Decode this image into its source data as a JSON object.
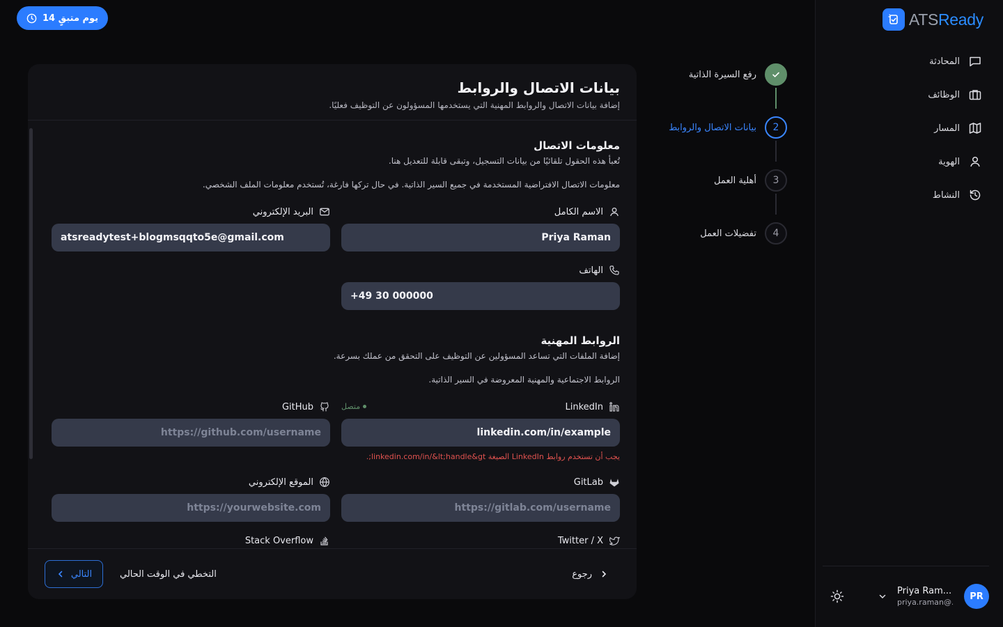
{
  "trial": {
    "label": "14 يوم متبقٍ",
    "icon": "clock-icon"
  },
  "brand": {
    "ats": "ATS",
    "ready": "Ready",
    "icon": "logo-icon"
  },
  "nav": {
    "items": [
      {
        "label": "المحادثة",
        "icon": "chat-icon"
      },
      {
        "label": "الوظائف",
        "icon": "briefcase-icon"
      },
      {
        "label": "المسار",
        "icon": "map-icon"
      },
      {
        "label": "الهوية",
        "icon": "user-icon"
      },
      {
        "label": "النشاط",
        "icon": "history-icon"
      }
    ]
  },
  "user": {
    "name": "Priya Ram...",
    "email": "priya.raman@...",
    "initials": "PR"
  },
  "stepper": {
    "steps": [
      {
        "label": "رفع السيرة الذاتية",
        "state": "done",
        "number": "✓"
      },
      {
        "label": "بيانات الاتصال والروابط",
        "state": "active",
        "number": "2"
      },
      {
        "label": "أهلية العمل",
        "state": "pending",
        "number": "3"
      },
      {
        "label": "تفضيلات العمل",
        "state": "pending",
        "number": "4"
      }
    ]
  },
  "card": {
    "title": "بيانات الاتصال والروابط",
    "subtitle": "إضافة بيانات الاتصال والروابط المهنية التي يستخدمها المسؤولون عن التوظيف فعليًا."
  },
  "contact": {
    "title": "معلومات الاتصال",
    "subtitle": "تُعبأ هذه الحقول تلقائيًا من بيانات التسجيل، وتبقى قابلة للتعديل هنا.",
    "note": "معلومات الاتصال الافتراضية المستخدمة في جميع السير الذاتية. في حال تركها فارغة، تُستخدم معلومات الملف الشخصي.",
    "full_name_label": "الاسم الكامل",
    "full_name_value": "Priya Raman",
    "email_label": "البريد الإلكتروني",
    "email_value": "atsreadytest+blogmsqqto5e@gmail.com",
    "phone_label": "الهاتف",
    "phone_value": "+49 30 000000"
  },
  "links": {
    "title": "الروابط المهنية",
    "subtitle": "إضافة الملفات التي تساعد المسؤولين عن التوظيف على التحقق من عملك بسرعة.",
    "note": "الروابط الاجتماعية والمهنية المعروضة في السير الذاتية.",
    "linkedin_label": "LinkedIn",
    "linkedin_status": "متصل",
    "linkedin_value": "linkedin.com/in/example",
    "linkedin_error": "يجب أن تستخدم روابط LinkedIn الصيغة linkedin.com/in/&lt;handle&gt;.",
    "github_label": "GitHub",
    "github_placeholder": "https://github.com/username",
    "gitlab_label": "GitLab",
    "gitlab_placeholder": "https://gitlab.com/username",
    "website_label": "الموقع الإلكتروني",
    "website_placeholder": "https://yourwebsite.com",
    "twitter_label": "Twitter / X",
    "stackoverflow_label": "Stack Overflow"
  },
  "footer": {
    "next": "التالي",
    "skip": "التخطي في الوقت الحالي",
    "back": "رجوع"
  }
}
